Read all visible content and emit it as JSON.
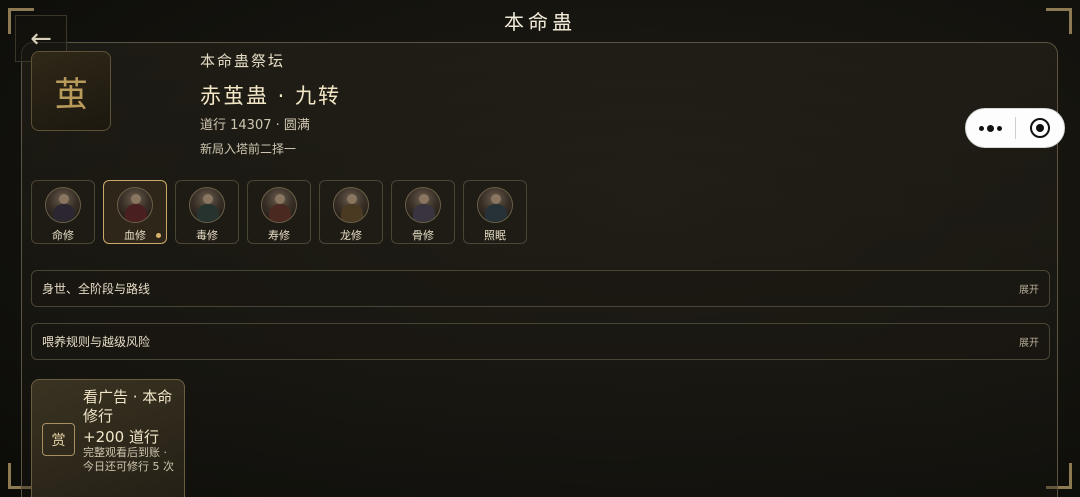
{
  "header": {
    "title": "本命蛊",
    "back_icon": "arrow-left-icon"
  },
  "hero": {
    "seal_char": "茧",
    "altar_label": "本命蛊祭坛",
    "gu_name": "赤茧蛊 · 九转",
    "cultivation": "道行 14307 · 圆满",
    "note": "新局入塔前二择一"
  },
  "capsule": {
    "more_icon": "more-dots-icon",
    "close_icon": "target-close-icon"
  },
  "paths": [
    {
      "label": "命修",
      "selected": false,
      "tone": "#2b2630"
    },
    {
      "label": "血修",
      "selected": true,
      "tone": "#4a1f20"
    },
    {
      "label": "毒修",
      "selected": false,
      "tone": "#26332e"
    },
    {
      "label": "寿修",
      "selected": false,
      "tone": "#4a2a20"
    },
    {
      "label": "龙修",
      "selected": false,
      "tone": "#4a3a22"
    },
    {
      "label": "骨修",
      "selected": false,
      "tone": "#3a3440"
    },
    {
      "label": "照眠",
      "selected": false,
      "tone": "#263238"
    }
  ],
  "sections": [
    {
      "title": "身世、全阶段与路线",
      "toggle": "展开"
    },
    {
      "title": "喂养规则与越级风险",
      "toggle": "展开"
    }
  ],
  "ad_card": {
    "badge": "赏",
    "title": "看广告 · 本命修行",
    "reward": "+200 道行",
    "note": "完整观看后到账 · 今日还可修行 5 次"
  },
  "colors": {
    "accent_gold": "#c9a86a",
    "background": "#14130e",
    "text": "#e6dcc4"
  }
}
